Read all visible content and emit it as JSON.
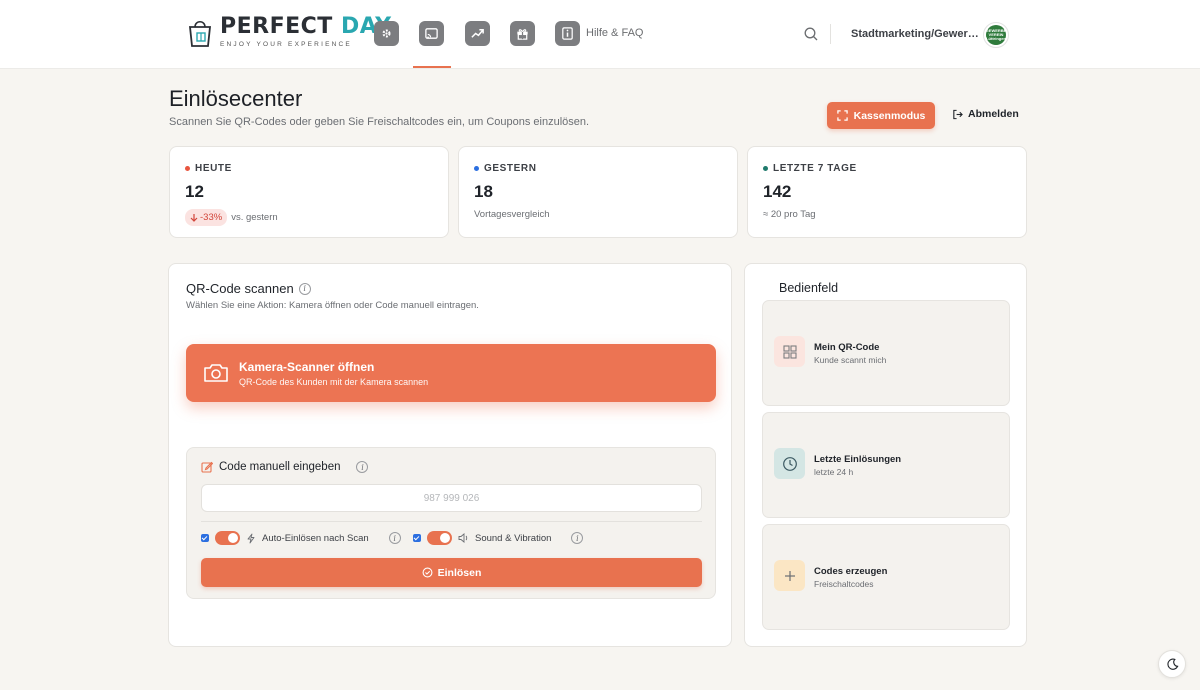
{
  "brand": {
    "name_part1": "PERFECT",
    "name_part2": "DAY",
    "tagline": "ENJOY YOUR EXPERIENCE"
  },
  "nav": {
    "items": [
      {
        "icon": "gear-icon"
      },
      {
        "icon": "cast-icon",
        "active": true
      },
      {
        "icon": "trending-icon"
      },
      {
        "icon": "gift-icon"
      },
      {
        "icon": "info-icon",
        "label": "Hilfe & FAQ"
      }
    ]
  },
  "header": {
    "org_name": "Stadtmarketing/Gewer…",
    "avatar_text_1": "GEWERBE",
    "avatar_text_2": "VEREIN",
    "avatar_text_3": "Lüttringen"
  },
  "page": {
    "title": "Einlösecenter",
    "subtitle": "Scannen Sie QR-Codes oder geben Sie Freischaltcodes ein, um Coupons einzulösen.",
    "kasse_label": "Kassenmodus",
    "logout_label": "Abmelden"
  },
  "stats": [
    {
      "label": "HEUTE",
      "value": "12",
      "badge": "-33%",
      "sub": "vs. gestern",
      "dot_color": "#e8553f"
    },
    {
      "label": "GESTERN",
      "value": "18",
      "sub": "Vortagesvergleich",
      "dot_color": "#2c6fe0"
    },
    {
      "label": "LETZTE 7 TAGE",
      "value": "142",
      "sub": "≈ 20 pro Tag",
      "dot_color": "#1f7a6c"
    }
  ],
  "scanner": {
    "title": "QR-Code scannen",
    "subtitle": "Wählen Sie eine Aktion: Kamera öffnen oder Code manuell eintragen.",
    "camera_title": "Kamera-Scanner öffnen",
    "camera_sub": "QR-Code des Kunden mit der Kamera scannen",
    "manual_title": "Code manuell eingeben",
    "input_placeholder": "987 999 026",
    "opt_auto": "Auto-Einlösen nach Scan",
    "opt_sound": "Sound & Vibration",
    "submit_label": "Einlösen",
    "info_glyph": "i"
  },
  "panel": {
    "title": "Bedienfeld",
    "tiles": [
      {
        "title": "Mein QR-Code",
        "sub": "Kunde scannt mich",
        "icon": "grid-icon",
        "bg": "#fbe5df"
      },
      {
        "title": "Letzte Einlösungen",
        "sub": "letzte 24 h",
        "icon": "clock-icon",
        "bg": "#d4e6e4"
      },
      {
        "title": "Codes erzeugen",
        "sub": "Freischaltcodes",
        "icon": "plus-icon",
        "bg": "#fbe6c4"
      }
    ]
  },
  "colors": {
    "accent": "#e8724f",
    "background": "#f7f5f1",
    "teal": "#2aa7b0"
  }
}
